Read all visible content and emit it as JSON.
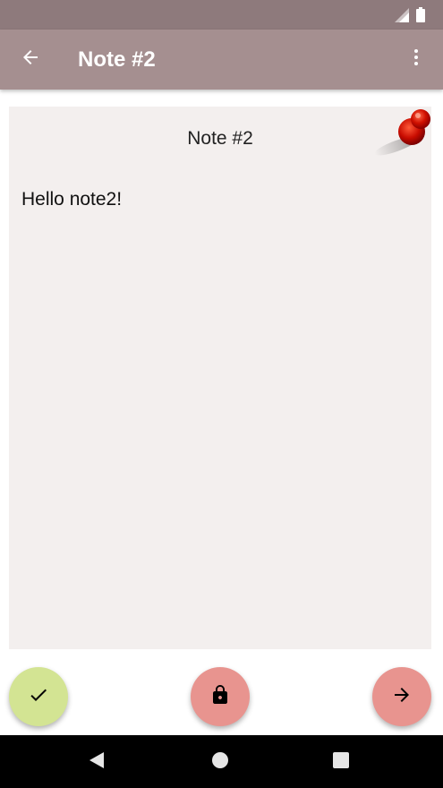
{
  "status_bar": {
    "icons": [
      "signal-icon",
      "battery-icon"
    ]
  },
  "app_bar": {
    "title": "Note #2",
    "back_icon": "arrow-back-icon",
    "menu_icon": "more-vert-icon"
  },
  "note": {
    "title": "Note #2",
    "body": "Hello note2!",
    "pin_icon": "pushpin-icon"
  },
  "fabs": {
    "done_icon": "check-icon",
    "lock_icon": "lock-icon",
    "next_icon": "arrow-forward-icon"
  },
  "nav_bar": {
    "icons": [
      "nav-back-icon",
      "nav-home-icon",
      "nav-recents-icon"
    ]
  },
  "colors": {
    "status_bar": "#8e7a7c",
    "app_bar": "#a58f90",
    "note_background": "#f3efee",
    "fab_done": "#d3e493",
    "fab_secondary": "#e8948f",
    "nav_bar": "#000000"
  }
}
